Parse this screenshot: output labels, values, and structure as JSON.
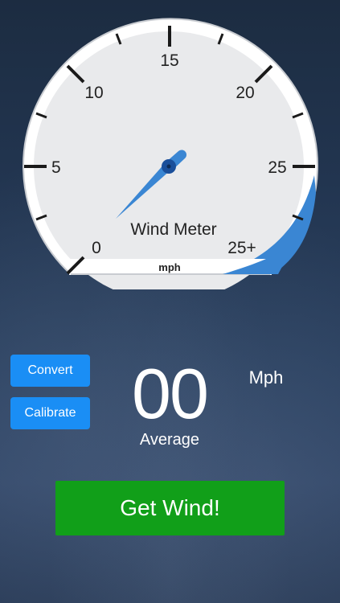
{
  "gauge": {
    "ticks": [
      "0",
      "5",
      "10",
      "15",
      "20",
      "25",
      "25+"
    ],
    "title": "Wind Meter",
    "unit_label": "mph",
    "needle_value": 0,
    "colors": {
      "face": "#e8e9eb",
      "rim": "#ffffff",
      "accent": "#3a86d3",
      "needle": "#3a86d3",
      "hub": "#1a4f9a"
    }
  },
  "controls": {
    "convert_label": "Convert",
    "calibrate_label": "Calibrate",
    "get_wind_label": "Get Wind!"
  },
  "readout": {
    "value": "00",
    "caption": "Average",
    "unit": "Mph"
  },
  "colors": {
    "small_button": "#1a8ef5",
    "primary_button": "#119f19"
  }
}
